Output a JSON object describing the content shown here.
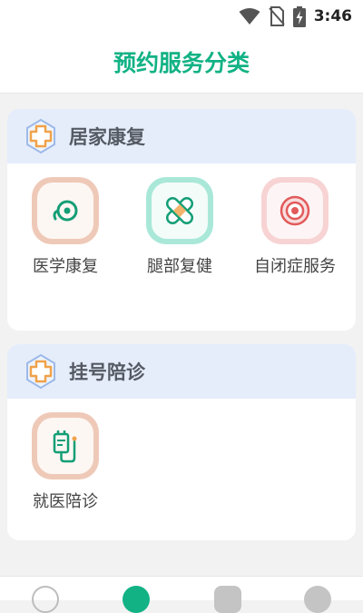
{
  "status_bar": {
    "time": "3:46"
  },
  "header": {
    "title": "预约服务分类"
  },
  "sections": [
    {
      "title": "居家康复",
      "items": [
        {
          "label": "医学康复",
          "icon": "rehab-icon"
        },
        {
          "label": "腿部复健",
          "icon": "bandage-icon"
        },
        {
          "label": "自闭症服务",
          "icon": "target-icon"
        }
      ]
    },
    {
      "title": "挂号陪诊",
      "items": [
        {
          "label": "就医陪诊",
          "icon": "iv-drip-icon"
        }
      ]
    }
  ],
  "colors": {
    "accent": "#12b285",
    "section_header_bg": "#e5edfb",
    "page_bg": "#f2f2f2"
  }
}
